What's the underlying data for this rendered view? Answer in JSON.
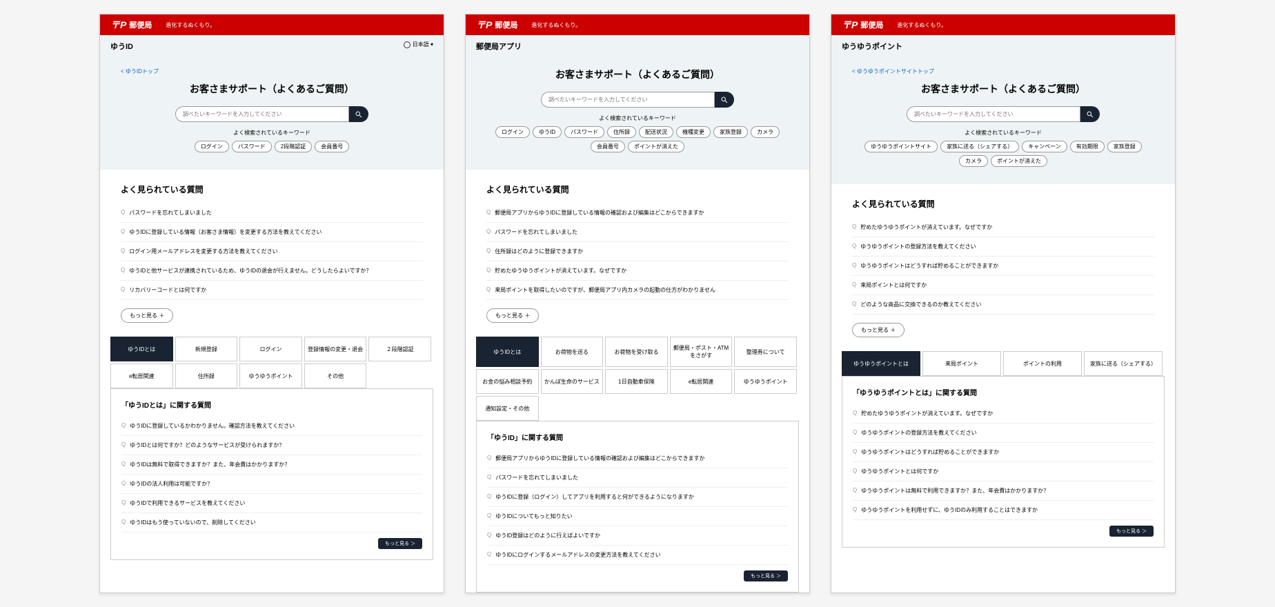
{
  "brand": "郵便局",
  "tagline": "進化するぬくもり。",
  "lang": "日本語",
  "page_title": "お客さまサポート（よくあるご質問）",
  "search_placeholder": "調べたいキーワードを入力してください",
  "kw_label": "よく検索されているキーワード",
  "faq_title": "よく見られている質問",
  "more_label": "もっと見る ＋",
  "more_label2": "もっと見る ＞",
  "panels": [
    {
      "subtitle": "ゆうID",
      "breadcrumb": "< ゆうIDトップ",
      "show_lang": true,
      "keywords": [
        "ログイン",
        "パスワード",
        "2段階認証",
        "会員番号"
      ],
      "faqs": [
        "パスワードを忘れてしまいました",
        "ゆうIDに登録している情報（お客さま情報）を変更する方法を教えてください",
        "ログイン用メールアドレスを変更する方法を教えてください",
        "ゆうIDと他サービスが連携されているため、ゆうIDの退会が行えません。どうしたらよいですか？",
        "リカバリーコードとは何ですか"
      ],
      "tabs": [
        "ゆうIDとは",
        "新規登録",
        "ログイン",
        "登録情報の変更・退会",
        "２段階認証",
        "e転居関連",
        "住所録",
        "ゆうゆうポイント",
        "その他"
      ],
      "tab_cols": 5,
      "tab_panel_title": "「ゆうIDとは」に関する質問",
      "tab_questions": [
        "ゆうIDに登録しているかわかりません。確認方法を教えてください",
        "ゆうIDとは何ですか？どのようなサービスが受けられますか？",
        "ゆうIDは無料で取得できますか？また、年会費はかかりますか？",
        "ゆうIDの法人利用は可能ですか？",
        "ゆうIDで利用できるサービスを教えてください",
        "ゆうIDはもう使っていないので、削除してください"
      ]
    },
    {
      "subtitle": "郵便局アプリ",
      "breadcrumb": "",
      "show_lang": false,
      "keywords": [
        "ログイン",
        "ゆうID",
        "パスワード",
        "住所録",
        "配送状況",
        "機種変更",
        "家族登録",
        "カメラ",
        "会員番号",
        "ポイントが消えた"
      ],
      "faqs": [
        "郵便局アプリからゆうIDに登録している情報の確認および編集はどこからできますか",
        "パスワードを忘れてしまいました",
        "住所録はどのように登録できますか",
        "貯めたゆうゆうポイントが消えています。なぜですか",
        "来局ポイントを取得したいのですが、郵便局アプリ内カメラの起動の仕方がわかりません"
      ],
      "tabs": [
        "ゆうIDとは",
        "お荷物を送る",
        "お荷物を受け取る",
        "郵便局・ポスト・ATMをさがす",
        "整理券について",
        "お金の悩み相談予約",
        "かんぽ生命のサービス",
        "1日自動車保険",
        "e転居関連",
        "ゆうゆうポイント",
        "通知設定・その他"
      ],
      "tab_cols": 5,
      "tab_panel_title": "「ゆうID」に関する質問",
      "tab_questions": [
        "郵便局アプリからゆうIDに登録している情報の確認および編集はどこからできますか",
        "パスワードを忘れてしまいました",
        "ゆうIDに登録（ログイン）してアプリを利用すると何ができるようになりますか",
        "ゆうIDについてもっと知りたい",
        "ゆうID登録はどのように行えばよいですか",
        "ゆうIDにログインするメールアドレスの変更方法を教えてください"
      ]
    },
    {
      "subtitle": "ゆうゆうポイント",
      "breadcrumb": "< ゆうゆうポイントサイトトップ",
      "show_lang": false,
      "keywords": [
        "ゆうゆうポイントサイト",
        "家族に送る（シェアする）",
        "キャンペーン",
        "有効期限",
        "家族登録",
        "カメラ",
        "ポイントが消えた"
      ],
      "faqs": [
        "貯めたゆうゆうポイントが消えています。なぜですか",
        "ゆうゆうポイントの登録方法を教えてください",
        "ゆうゆうポイントはどうすれば貯めることができますか",
        "来局ポイントとは何ですか",
        "どのような商品に交換できるのか教えてください"
      ],
      "tabs": [
        "ゆうゆうポイントとは",
        "来局ポイント",
        "ポイントの利用",
        "家族に送る（シェアする）"
      ],
      "tab_cols": 4,
      "tab_panel_title": "「ゆうゆうポイントとは」に関する質問",
      "tab_questions": [
        "貯めたゆうゆうポイントが消えています。なぜですか",
        "ゆうゆうポイントの登録方法を教えてください",
        "ゆうゆうポイントはどうすれば貯めることができますか",
        "ゆうゆうポイントとは何ですか",
        "ゆうゆうポイントは無料で利用できますか？また、年会費はかかりますか？",
        "ゆうゆうポイントを利用せずに、ゆうIDのみ利用することはできますか"
      ]
    }
  ]
}
